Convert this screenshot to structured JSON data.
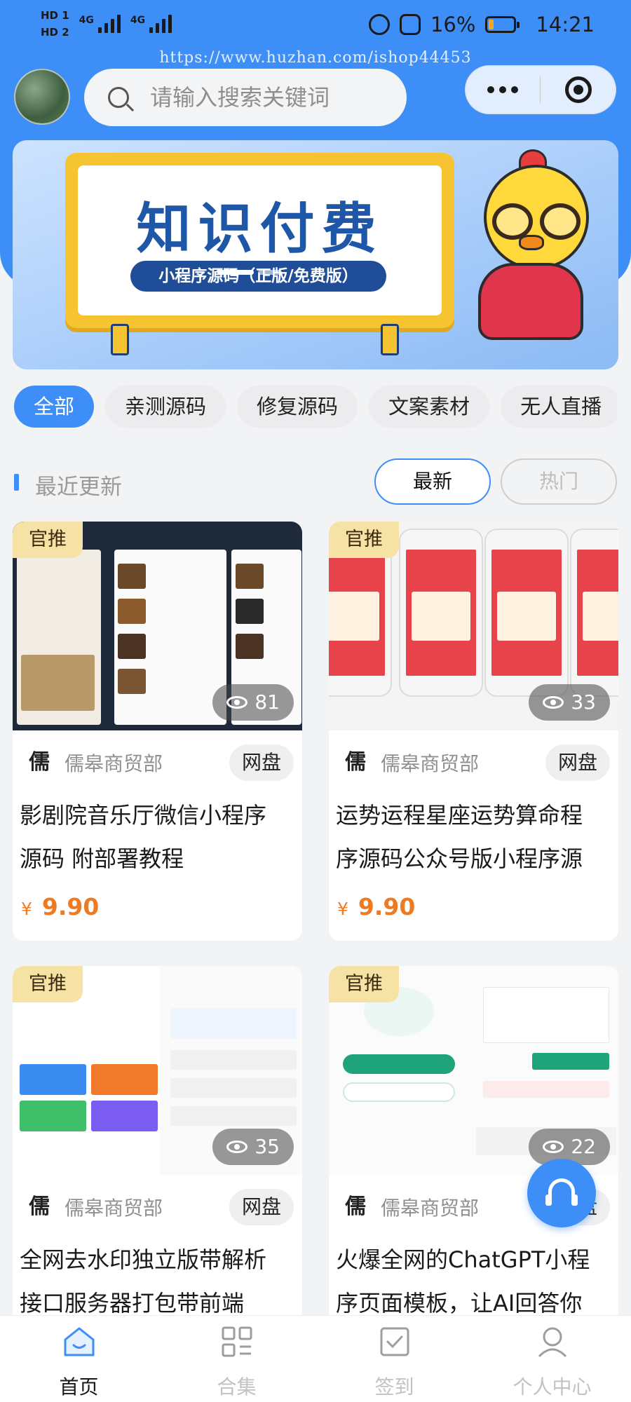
{
  "status_bar": {
    "hd1": "HD 1",
    "hd2": "HD 2",
    "signal1": "4G",
    "signal2": "4G",
    "battery": "16%",
    "time": "14:21",
    "battery_level": 0.16
  },
  "watermark": "https://www.huzhan.com/ishop44453",
  "search": {
    "placeholder": "请输入搜索关键词"
  },
  "banner": {
    "title": "知识付费",
    "subtitle": "小程序源码（正版/免费版）"
  },
  "categories": [
    "全部",
    "亲测源码",
    "修复源码",
    "文案素材",
    "无人直播"
  ],
  "section": {
    "title": "最近更新",
    "sort_latest": "最新",
    "sort_hot": "热门"
  },
  "cards": [
    {
      "badge": "官推",
      "views": "81",
      "shop": "儒皋商贸部",
      "shop_logo": "儒",
      "tag": "网盘",
      "title_line1": "影剧院音乐厅微信小程序",
      "title_line2": "源码 附部署教程",
      "currency": "¥",
      "price": "9.90"
    },
    {
      "badge": "官推",
      "views": "33",
      "shop": "儒皋商贸部",
      "shop_logo": "儒",
      "tag": "网盘",
      "title_line1": "运势运程星座运势算命程",
      "title_line2": "序源码公众号版小程序源",
      "currency": "¥",
      "price": "9.90"
    },
    {
      "badge": "官推",
      "views": "35",
      "shop": "儒皋商贸部",
      "shop_logo": "儒",
      "tag": "网盘",
      "title_line1": "全网去水印独立版带解析",
      "title_line2": "接口服务器打包带前端"
    },
    {
      "badge": "官推",
      "views": "22",
      "shop": "儒皋商贸部",
      "shop_logo": "儒",
      "tag": "网盘",
      "title_line1": "火爆全网的ChatGPT小程",
      "title_line2": "序页面模板，让AI回答你"
    }
  ],
  "tabbar": [
    {
      "label": "首页",
      "icon": "home-icon",
      "active": true
    },
    {
      "label": "合集",
      "icon": "grid-icon",
      "active": false
    },
    {
      "label": "签到",
      "icon": "checkin-icon",
      "active": false
    },
    {
      "label": "个人中心",
      "icon": "profile-icon",
      "active": false
    }
  ],
  "colors": {
    "primary": "#3e8ef7",
    "price": "#ee7a22",
    "badge": "#f7e2a6"
  }
}
